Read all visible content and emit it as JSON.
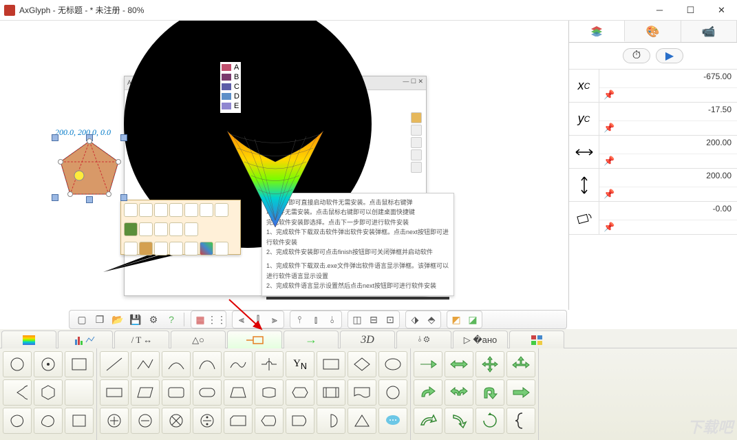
{
  "title": "AxGlyph - 无标题 - * 未注册 - 80%",
  "coords": "200.0, 200.0, 0.0",
  "subwin_title": "AxGlyph - 无标题 -",
  "legend": [
    "A",
    "B",
    "C",
    "D",
    "E"
  ],
  "legend_colors": [
    "#c0506e",
    "#7a3b6e",
    "#5d5da8",
    "#5d8fc8",
    "#8f86d0"
  ],
  "textdoc": {
    "l1": "exe文件即可直接启动软件无需安装。点击鼠标右键弹",
    "l2": "动软件无需安装。点击鼠标右键即可以创建桌面快捷键",
    "l3": "完成软件安装即选择。点击下一步即可进行软件安装",
    "l4": "1、完成软件下载双击软件弹出软件安装弹框。点击next按钮即可进行软件安装",
    "l5": "2、完成软件安装即可点击finish按钮即可关闭弹框并启动软件",
    "b1": "1、完成软件下载双击.exe文件弹出软件语言显示弹框。该弹框可以进行软件语言显示设置",
    "b2": "2、完成软件语言显示设置然后点击next按钮即可进行软件安装"
  },
  "props": {
    "xc_label": "x",
    "xc_sub": "C",
    "xc_val": "-675.00",
    "yc_label": "y",
    "yc_sub": "C",
    "yc_val": "-17.50",
    "w_val": "200.00",
    "h_val": "200.00",
    "r_val": "-0.00"
  },
  "cats": {
    "c3d": "3D"
  },
  "watermark": "下载吧"
}
